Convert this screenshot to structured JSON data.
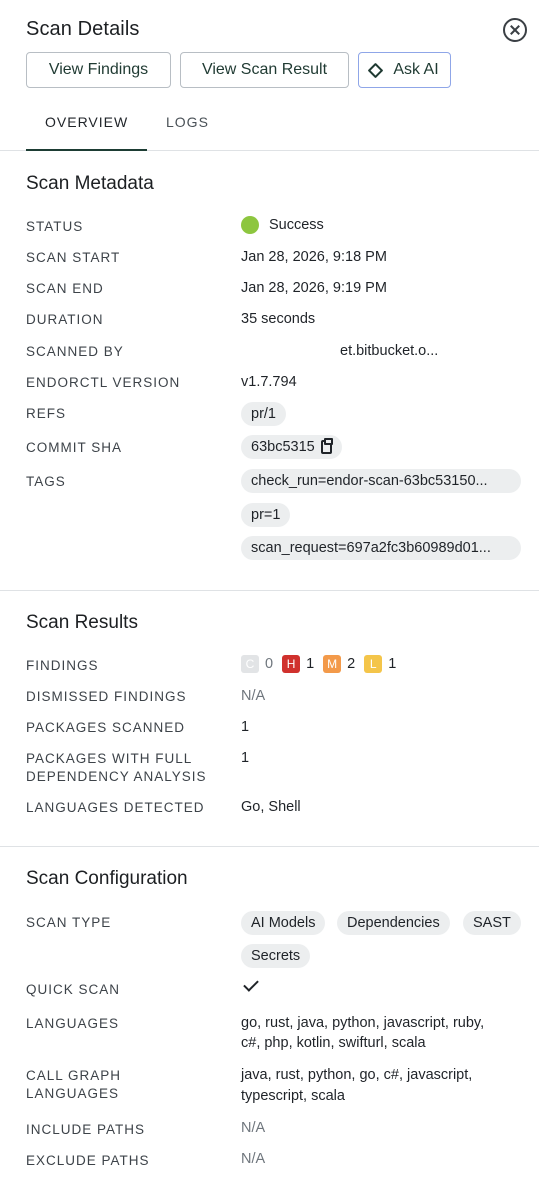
{
  "header": {
    "title": "Scan Details"
  },
  "actions": {
    "view_findings": "View Findings",
    "view_scan_result": "View Scan Result",
    "ask_ai": "Ask AI"
  },
  "tabs": {
    "overview": "OVERVIEW",
    "logs": "LOGS"
  },
  "metadata": {
    "title": "Scan Metadata",
    "status_label": "STATUS",
    "status_value": "Success",
    "scan_start_label": "SCAN START",
    "scan_start_value": "Jan 28, 2026, 9:18 PM",
    "scan_end_label": "SCAN END",
    "scan_end_value": "Jan 28, 2026, 9:19 PM",
    "duration_label": "DURATION",
    "duration_value": "35 seconds",
    "scanned_by_label": "SCANNED BY",
    "scanned_by_value": "et.bitbucket.o...",
    "endorctl_label": "ENDORCTL VERSION",
    "endorctl_value": "v1.7.794",
    "refs_label": "REFS",
    "refs_value": "pr/1",
    "commit_label": "COMMIT SHA",
    "commit_value": "63bc5315",
    "tags_label": "TAGS",
    "tags": [
      "check_run=endor-scan-63bc53150...",
      "pr=1",
      "scan_request=697a2fc3b60989d01..."
    ]
  },
  "results": {
    "title": "Scan Results",
    "findings_label": "FINDINGS",
    "findings": {
      "c_letter": "C",
      "c_count": "0",
      "h_letter": "H",
      "h_count": "1",
      "m_letter": "M",
      "m_count": "2",
      "l_letter": "L",
      "l_count": "1"
    },
    "dismissed_label": "DISMISSED FINDINGS",
    "dismissed_value": "N/A",
    "packages_label": "PACKAGES SCANNED",
    "packages_value": "1",
    "full_dep_label_1": "PACKAGES WITH FULL",
    "full_dep_label_2": "DEPENDENCY ANALYSIS",
    "full_dep_value": "1",
    "languages_label": "LANGUAGES DETECTED",
    "languages_value": "Go, Shell"
  },
  "config": {
    "title": "Scan Configuration",
    "scan_type_label": "SCAN TYPE",
    "scan_types": [
      "AI Models",
      "Dependencies",
      "SAST",
      "Secrets"
    ],
    "quick_scan_label": "QUICK SCAN",
    "languages_label": "LANGUAGES",
    "languages_line1": "go, rust, java, python, javascript, ruby,",
    "languages_line2": "c#, php, kotlin, swifturl, scala",
    "call_graph_label_1": "CALL GRAPH",
    "call_graph_label_2": "LANGUAGES",
    "call_graph_line1": "java, rust, python, go, c#, javascript,",
    "call_graph_line2": "typescript, scala",
    "include_label": "INCLUDE PATHS",
    "include_value": "N/A",
    "exclude_label": "EXCLUDE PATHS",
    "exclude_value": "N/A"
  },
  "colors": {
    "success": "#8dc63f",
    "high": "#d0312d",
    "medium": "#f39a4a",
    "low": "#f4c54a",
    "accent": "#1d3d34",
    "ai_border": "#8fa6e8"
  }
}
